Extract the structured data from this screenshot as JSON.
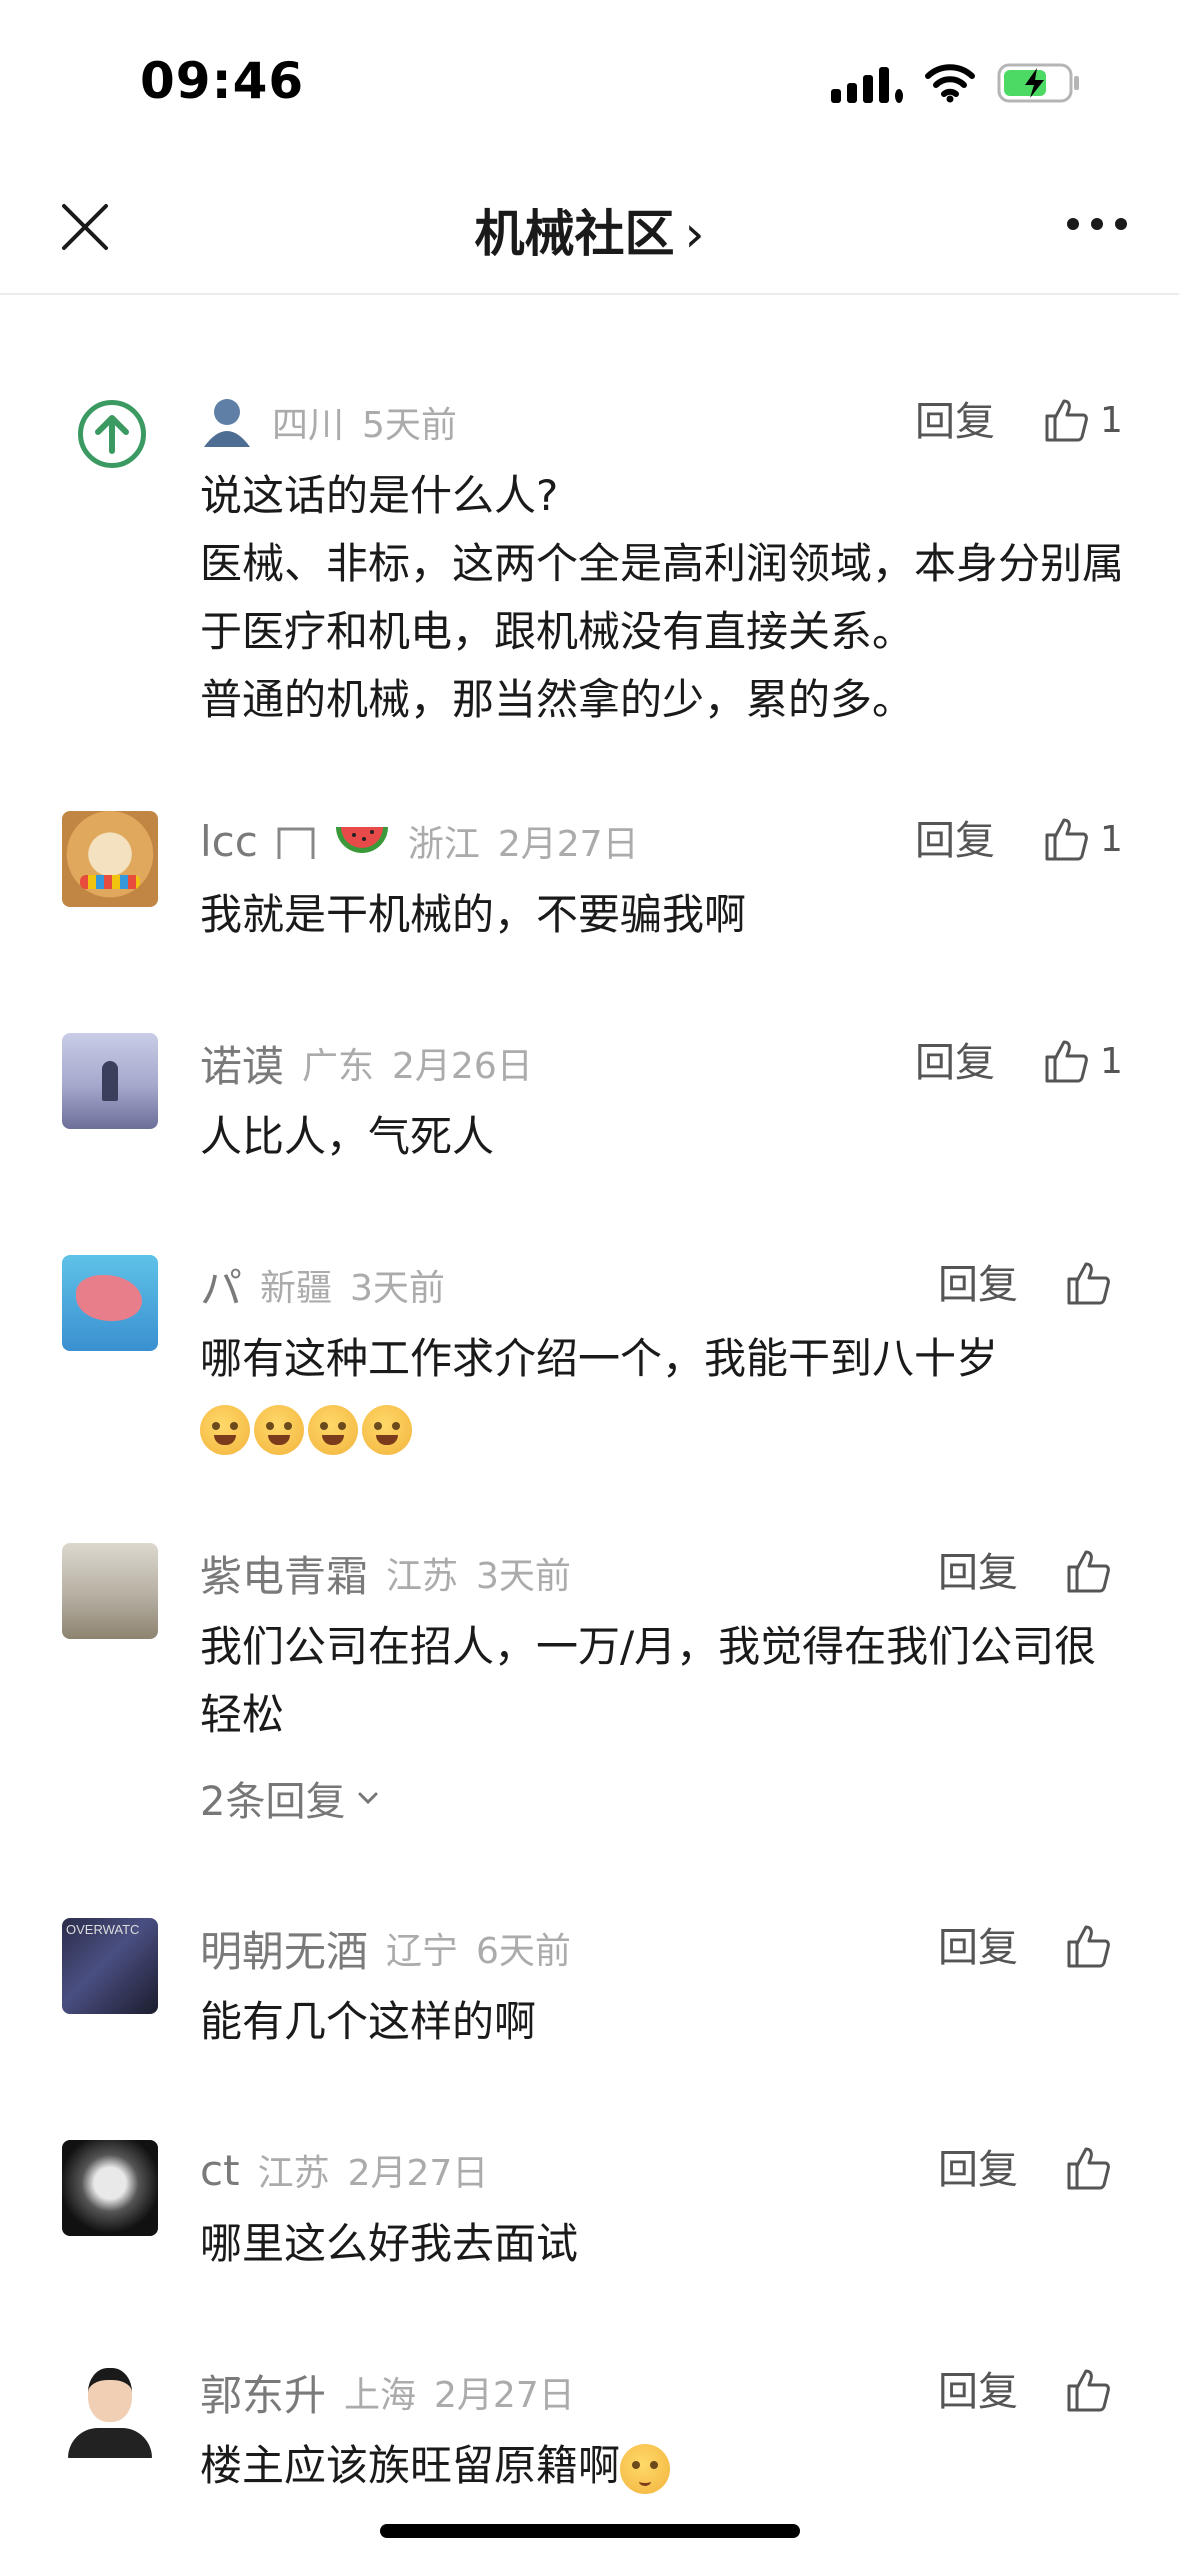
{
  "status_bar": {
    "time": "09:46"
  },
  "nav": {
    "title": "机械社区",
    "title_chevron": "›"
  },
  "comments": [
    {
      "name": "",
      "region": "四川",
      "time": "5天前",
      "reply_label": "回复",
      "likes": "1",
      "text": "说这话的是什么人?\n医械、非标，这两个全是高利润领域，本身分别属于医疗和机电，跟机械没有直接关系。\n普通的机械，那当然拿的少，累的多。"
    },
    {
      "name": "lcc",
      "region": "浙江",
      "time": "2月27日",
      "reply_label": "回复",
      "likes": "1",
      "text": "我就是干机械的，不要骗我啊"
    },
    {
      "name": "诺谟",
      "region": "广东",
      "time": "2月26日",
      "reply_label": "回复",
      "likes": "1",
      "text": "人比人，气死人"
    },
    {
      "name": "パ",
      "region": "新疆",
      "time": "3天前",
      "reply_label": "回复",
      "likes": "",
      "text": "哪有这种工作求介绍一个，我能干到八十岁"
    },
    {
      "name": "紫电青霜",
      "region": "江苏",
      "time": "3天前",
      "reply_label": "回复",
      "likes": "",
      "text": "我们公司在招人，一万/月，我觉得在我们公司很轻松",
      "sub_replies": "2条回复"
    },
    {
      "name": "明朝无酒",
      "region": "辽宁",
      "time": "6天前",
      "reply_label": "回复",
      "likes": "",
      "text": "能有几个这样的啊"
    },
    {
      "name": "ct",
      "region": "江苏",
      "time": "2月27日",
      "reply_label": "回复",
      "likes": "",
      "text": "哪里这么好我去面试"
    },
    {
      "name": "郭东升",
      "region": "上海",
      "time": "2月27日",
      "reply_label": "回复",
      "likes": "",
      "text": "楼主应该族旺留原籍啊"
    }
  ],
  "icons": {
    "close": "close-icon",
    "more": "more-icon",
    "like": "thumbs-up-icon",
    "chevron_down": "chevron-down-icon"
  },
  "colors": {
    "accent_green": "#3a9a62",
    "text_gray": "#7a7a7a"
  }
}
